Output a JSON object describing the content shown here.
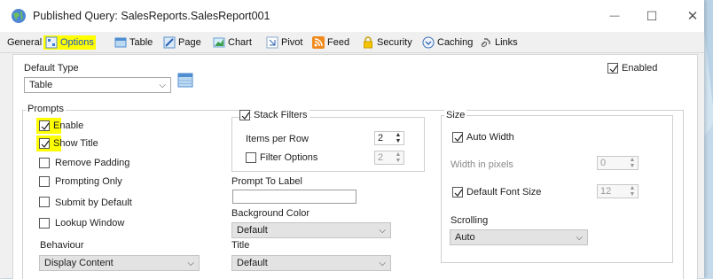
{
  "window": {
    "title": "Published Query: SalesReports.SalesReport001",
    "minimize": "—",
    "maximize": "☐",
    "close": "✕"
  },
  "tabs": [
    {
      "label": "General",
      "icon": "none"
    },
    {
      "label": "Options",
      "icon": "options-icon",
      "selected": true
    },
    {
      "label": "Table",
      "icon": "table-icon"
    },
    {
      "label": "Page",
      "icon": "page-icon"
    },
    {
      "label": "Chart",
      "icon": "chart-icon"
    },
    {
      "label": "Pivot",
      "icon": "pivot-icon"
    },
    {
      "label": "Feed",
      "icon": "rss-feed-icon"
    },
    {
      "label": "Security",
      "icon": "lock-icon"
    },
    {
      "label": "Caching",
      "icon": "caching-icon"
    },
    {
      "label": "Links",
      "icon": "link-icon"
    }
  ],
  "default_type": {
    "label": "Default Type",
    "value": "Table"
  },
  "enabled": {
    "label": "Enabled",
    "checked": true
  },
  "prompts": {
    "title": "Prompts",
    "enable": {
      "label": "Enable",
      "checked": true
    },
    "show_title": {
      "label": "Show Title",
      "checked": true
    },
    "remove_padding": {
      "label": "Remove Padding",
      "checked": false
    },
    "prompting_only": {
      "label": "Prompting Only",
      "checked": false
    },
    "submit_by_default": {
      "label": "Submit by Default",
      "checked": false
    },
    "lookup_window": {
      "label": "Lookup Window",
      "checked": false
    },
    "behaviour_label": "Behaviour",
    "behaviour_value": "Display Content"
  },
  "stack_filters": {
    "label": "Stack Filters",
    "checked": true,
    "items_per_row_label": "Items per Row",
    "items_per_row_value": "2",
    "filter_options_label": "Filter Options",
    "filter_options_checked": false,
    "filter_options_value": "2"
  },
  "prompt_to_label": {
    "label": "Prompt To Label",
    "value": ""
  },
  "background_color": {
    "label": "Background Color",
    "value": "Default"
  },
  "title_field": {
    "label": "Title",
    "value": "Default"
  },
  "size": {
    "title": "Size",
    "auto_width": {
      "label": "Auto Width",
      "checked": true
    },
    "width_in_pixels_label": "Width in pixels",
    "width_in_pixels_value": "0",
    "default_font_size": {
      "label": "Default Font Size",
      "checked": true
    },
    "font_size_value": "12",
    "scrolling_label": "Scrolling",
    "scrolling_value": "Auto"
  },
  "colors": {
    "highlight": "#ffff00",
    "selected_tab_text": "#1a50c8"
  }
}
